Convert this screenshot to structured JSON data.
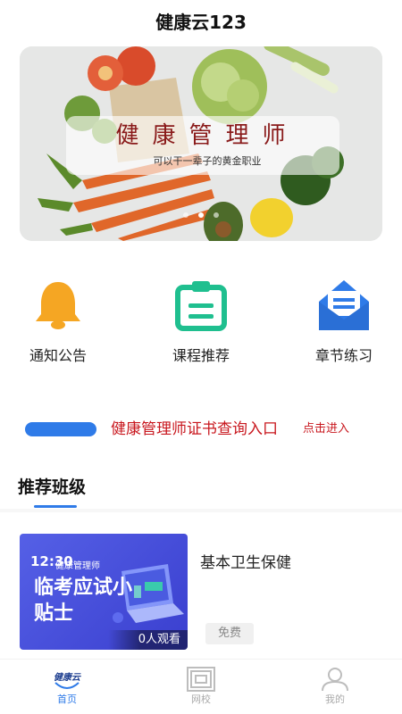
{
  "app": {
    "title": "健康云123"
  },
  "banner": {
    "title": "健康管理师",
    "subtitle": "可以干一辈子的黄金职业",
    "slide_count": 3,
    "active_slide": 2
  },
  "quick_nav": [
    {
      "label": "通知公告",
      "icon": "bell-icon",
      "color": "#f5a623"
    },
    {
      "label": "课程推荐",
      "icon": "clipboard-icon",
      "color": "#1fbf8f"
    },
    {
      "label": "章节练习",
      "icon": "mail-icon",
      "color": "#2f7be8"
    }
  ],
  "cert_entry": {
    "text": "健康管理师证书查询入口",
    "action": "点击进入",
    "color": "#c8161d"
  },
  "recommend": {
    "section_title": "推荐班级",
    "courses": [
      {
        "name": "基本卫生保健",
        "price": "免费",
        "thumb": {
          "time": "12:30",
          "brand": "健康管理师",
          "headline": "临考应试小贴士",
          "views": "0人观看"
        }
      }
    ]
  },
  "tabbar": {
    "home_logo": "健康云",
    "items": [
      {
        "label": "首页",
        "icon": "home-logo-icon",
        "active": true
      },
      {
        "label": "网校",
        "icon": "school-icon",
        "active": false
      },
      {
        "label": "我的",
        "icon": "user-icon",
        "active": false
      }
    ]
  },
  "colors": {
    "accent": "#2f7be8",
    "cert_red": "#c8161d",
    "banner_title": "#8a1b1b"
  }
}
